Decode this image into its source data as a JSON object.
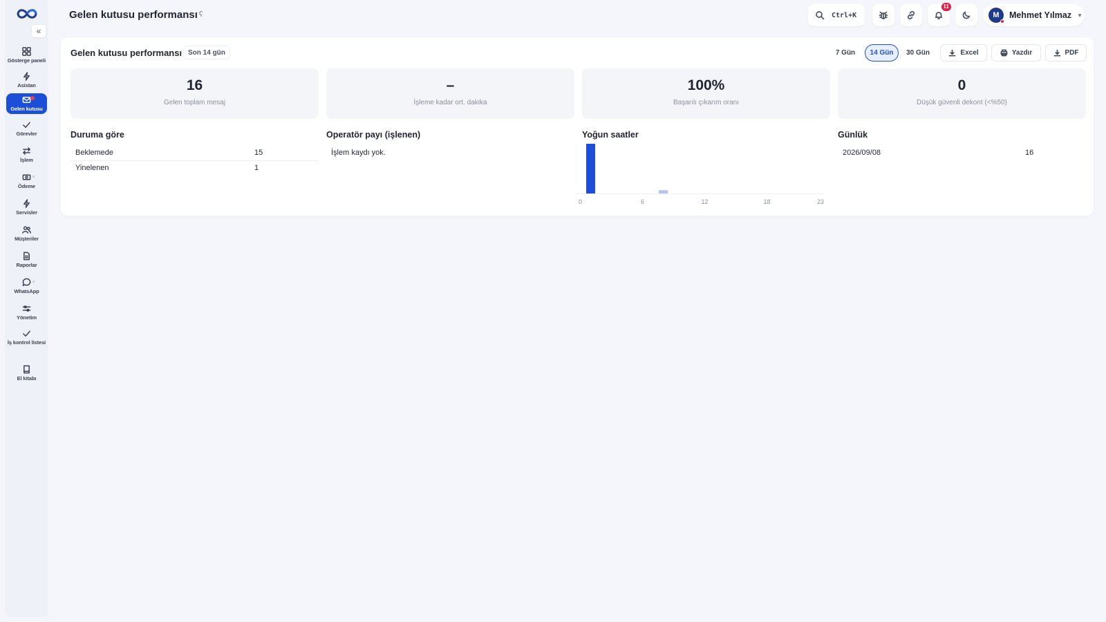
{
  "header": {
    "title": "Gelen kutusu performansı",
    "title_mark": "ʕ",
    "search_shortcut": "Ctrl+K",
    "notifications_count": "11",
    "user": {
      "initial": "M",
      "name": "Mehmet Yılmaz"
    }
  },
  "sidebar": {
    "collapse": "«",
    "items": [
      {
        "label": "Gösterge paneli",
        "icon": "dashboard-grid-icon"
      },
      {
        "label": "Asistan",
        "icon": "bolt-icon"
      },
      {
        "label": "Gelen kutusu",
        "icon": "inbox-icon",
        "active": true
      },
      {
        "label": "Görevler",
        "icon": "check-icon"
      },
      {
        "label": "İşlem",
        "icon": "transfer-icon"
      },
      {
        "label": "Ödeme",
        "icon": "payment-icon"
      },
      {
        "label": "Servisler",
        "icon": "bolt-icon"
      },
      {
        "label": "Müşteriler",
        "icon": "users-icon"
      },
      {
        "label": "Raporlar",
        "icon": "report-icon"
      },
      {
        "label": "WhatsApp",
        "icon": "chat-icon"
      },
      {
        "label": "Yönetim",
        "icon": "sliders-icon"
      },
      {
        "label": "İş kontrol listesi",
        "icon": "check-icon"
      },
      {
        "label": "El kitabı",
        "icon": "book-icon"
      }
    ]
  },
  "report": {
    "title": "Gelen kutusu performansı",
    "range_label": "Son 14 gün",
    "range_options": [
      "7 Gün",
      "14 Gün",
      "30 Gün"
    ],
    "selected_range": "14 Gün",
    "actions": {
      "excel": "Excel",
      "print": "Yazdır",
      "pdf": "PDF"
    },
    "stats": [
      {
        "value": "16",
        "caption": "Gelen toplam mesaj"
      },
      {
        "value": "–",
        "caption": "İşleme kadar ort. dakika"
      },
      {
        "value": "100%",
        "caption": "Başarılı çıkarım oranı"
      },
      {
        "value": "0",
        "caption": "Düşük güvenli dekont (<%50)"
      }
    ],
    "by_status": {
      "title": "Duruma göre",
      "rows": [
        {
          "label": "Beklemede",
          "value": "15"
        },
        {
          "label": "Yinelenen",
          "value": "1"
        }
      ]
    },
    "operator_share": {
      "title": "Operatör payı (işlenen)",
      "empty": "İşlem kaydı yok."
    },
    "busy_hours": {
      "title": "Yoğun saatler"
    },
    "daily": {
      "title": "Günlük",
      "rows": [
        {
          "date": "2026/09/08",
          "value": "16"
        }
      ]
    }
  },
  "colors": {
    "accent": "#1d4ed8",
    "accent_light": "#b4c3f2"
  },
  "chart_data": {
    "type": "bar",
    "title": "Yoğun saatler",
    "x": [
      0,
      1,
      2,
      3,
      4,
      5,
      6,
      7,
      8,
      9,
      10,
      11,
      12,
      13,
      14,
      15,
      16,
      17,
      18,
      19,
      20,
      21,
      22,
      23
    ],
    "values": [
      0,
      15,
      0,
      0,
      0,
      0,
      0,
      0,
      1,
      0,
      0,
      0,
      0,
      0,
      0,
      0,
      0,
      0,
      0,
      0,
      0,
      0,
      0,
      0
    ],
    "highlight_hour": 1,
    "xticks": [
      0,
      6,
      12,
      18,
      23
    ],
    "ylim": [
      0,
      15
    ],
    "grid": false
  }
}
